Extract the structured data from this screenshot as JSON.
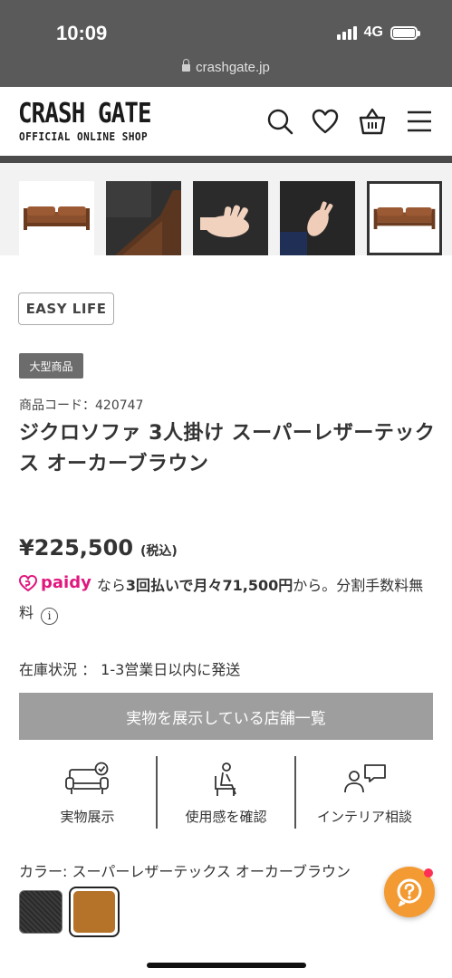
{
  "status_bar": {
    "time": "10:09",
    "network": "4G",
    "url": "crashgate.jp"
  },
  "header": {
    "logo_main": "CRASH GATE",
    "logo_sub": "OFFICIAL ONLINE SHOP",
    "icons": [
      "search-icon",
      "heart-icon",
      "cart-icon",
      "menu-icon"
    ]
  },
  "thumbnails": [
    {
      "name": "sofa-front",
      "active": false
    },
    {
      "name": "armrest-closeup",
      "active": false
    },
    {
      "name": "hand-on-fabric",
      "active": false
    },
    {
      "name": "hand-on-surface",
      "active": false
    },
    {
      "name": "sofa-front-selected",
      "active": true
    }
  ],
  "product": {
    "series_badge": "EASY LIFE",
    "size_tag": "大型商品",
    "code": "商品コード：420747",
    "title": "ジクロソファ 3人掛け スーパーレザーテックス オーカーブラウン",
    "price": "¥225,500",
    "tax_note": "(税込)",
    "paidy": {
      "brand": "paidy",
      "text_before": "なら",
      "highlight": "3回払いで月々71,500円",
      "text_after": "から。分割手数料無料"
    },
    "stock": "在庫状況 ： 1-3営業日以内に発送",
    "store_button": "実物を展示している店舗一覧",
    "features": [
      {
        "label": "実物展示",
        "icon": "sofa-check-icon"
      },
      {
        "label": "使用感を確認",
        "icon": "chair-person-icon"
      },
      {
        "label": "インテリア相談",
        "icon": "consult-icon"
      }
    ],
    "color_label": "カラー: スーパーレザーテックス オーカーブラウン",
    "colors": [
      {
        "name": "black",
        "hex": "#2f2f2f",
        "selected": false
      },
      {
        "name": "ochre-brown",
        "hex": "#b5732a",
        "selected": true
      }
    ]
  },
  "accent_colors": {
    "paidy": "#e0177e",
    "help": "#f39a32"
  }
}
